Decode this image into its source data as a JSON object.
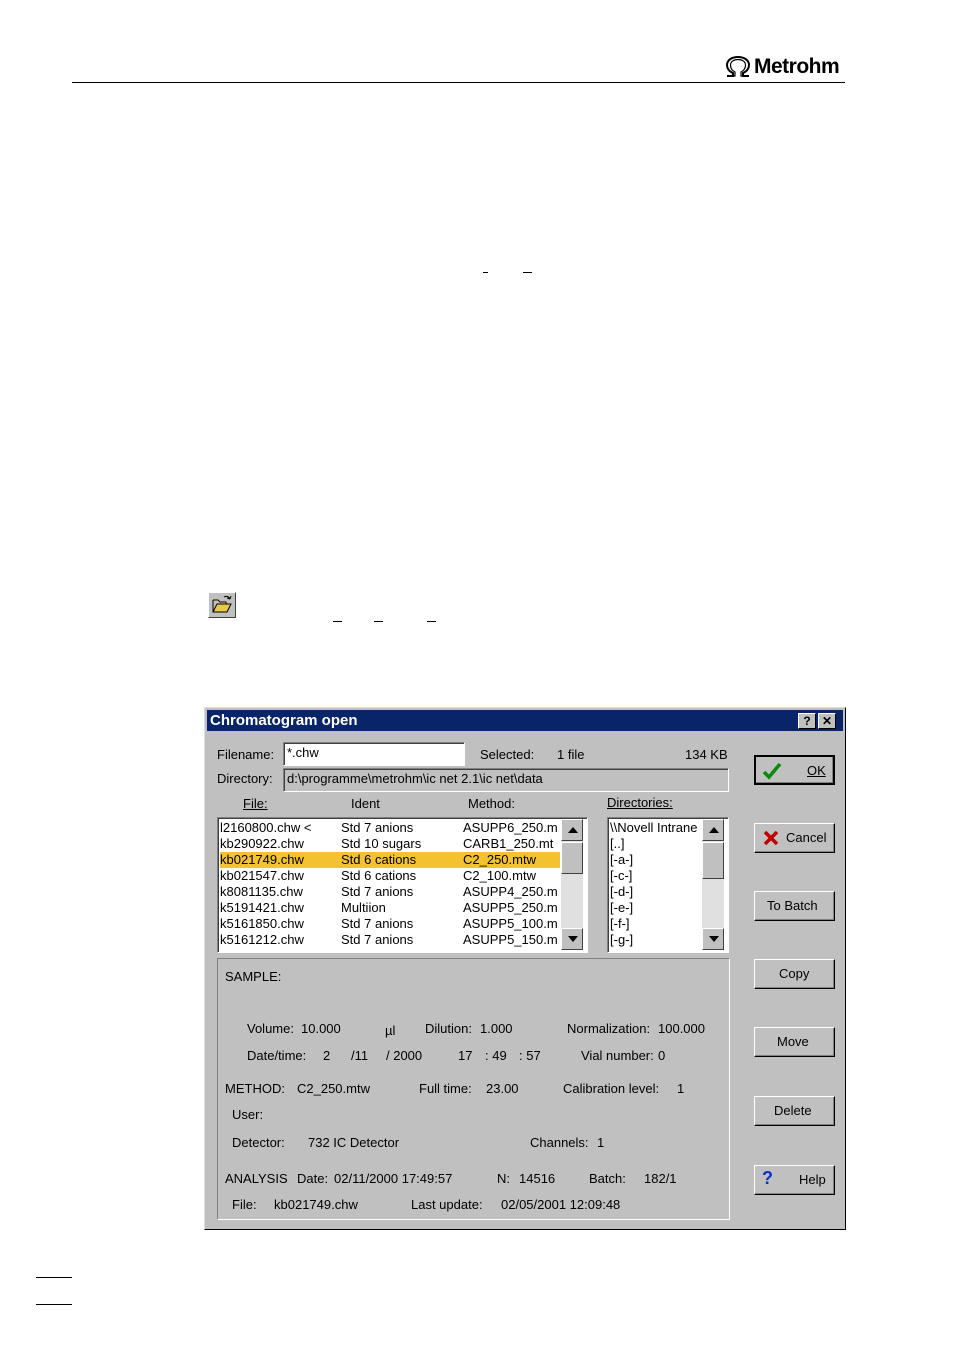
{
  "header": {
    "brand": "Metrohm"
  },
  "dialog": {
    "title": "Chromatogram open",
    "help_btn": "?",
    "close_btn": "✕",
    "filename_label": "Filename:",
    "filename_value": "*.chw",
    "selected_label": "Selected:",
    "selected_value": "1 file",
    "size_value": "134 KB",
    "directory_label": "Directory:",
    "directory_value": "d:\\programme\\metrohm\\ic net 2.1\\ic net\\data",
    "col_file": "File:",
    "col_ident": "Ident",
    "col_method": "Method:",
    "dirs_label": "Directories:",
    "files": [
      {
        "file": "l2160800.chw <",
        "ident": "Std 7 anions",
        "method": "ASUPP6_250.m"
      },
      {
        "file": "kb290922.chw",
        "ident": "Std 10 sugars",
        "method": "CARB1_250.mt"
      },
      {
        "file": "kb021749.chw",
        "ident": "Std 6 cations",
        "method": "C2_250.mtw"
      },
      {
        "file": "kb021547.chw",
        "ident": "Std 6 cations",
        "method": "C2_100.mtw"
      },
      {
        "file": "k8081135.chw",
        "ident": "Std 7 anions",
        "method": "ASUPP4_250.m"
      },
      {
        "file": "k5191421.chw",
        "ident": "Multiion",
        "method": "ASUPP5_250.m"
      },
      {
        "file": "k5161850.chw",
        "ident": "Std 7 anions",
        "method": "ASUPP5_100.m"
      },
      {
        "file": "k5161212.chw",
        "ident": "Std 7 anions",
        "method": "ASUPP5_150.m"
      }
    ],
    "directories": [
      "\\\\Novell Intrane",
      "[..]",
      "[-a-]",
      "[-c-]",
      "[-d-]",
      "[-e-]",
      "[-f-]",
      "[-g-]"
    ],
    "info": {
      "sample_label": "SAMPLE:",
      "volume_label": "Volume:",
      "volume_value": "10.000",
      "volume_unit": "µl",
      "dilution_label": "Dilution:",
      "dilution_value": "1.000",
      "normalization_label": "Normalization:",
      "normalization_value": "100.000",
      "datetime_label": "Date/time:",
      "day": "2",
      "month": "/11",
      "year": "/ 2000",
      "hour": "17",
      "minute": ": 49",
      "second": ": 57",
      "vial_label": "Vial number:",
      "vial_value": "0",
      "method_label": "METHOD:",
      "method_value": "C2_250.mtw",
      "fulltime_label": "Full time:",
      "fulltime_value": "23.00",
      "callevel_label": "Calibration level:",
      "callevel_value": "1",
      "user_label": "User:",
      "detector_label": "Detector:",
      "detector_value": "732 IC Detector",
      "channels_label": "Channels:",
      "channels_value": "1",
      "analysis_label": "ANALYSIS",
      "analysis_date_label": "Date:",
      "analysis_date_value": "02/11/2000 17:49:57",
      "n_label": "N:",
      "n_value": "14516",
      "batch_label": "Batch:",
      "batch_value": "182/1",
      "file_label": "File:",
      "file_value": "kb021749.chw",
      "lastupdate_label": "Last update:",
      "lastupdate_value": "02/05/2001 12:09:48"
    },
    "buttons": {
      "ok": "OK",
      "cancel": "Cancel",
      "to_batch": "To Batch",
      "copy": "Copy",
      "move": "Move",
      "delete": "Delete",
      "help": "Help"
    }
  }
}
